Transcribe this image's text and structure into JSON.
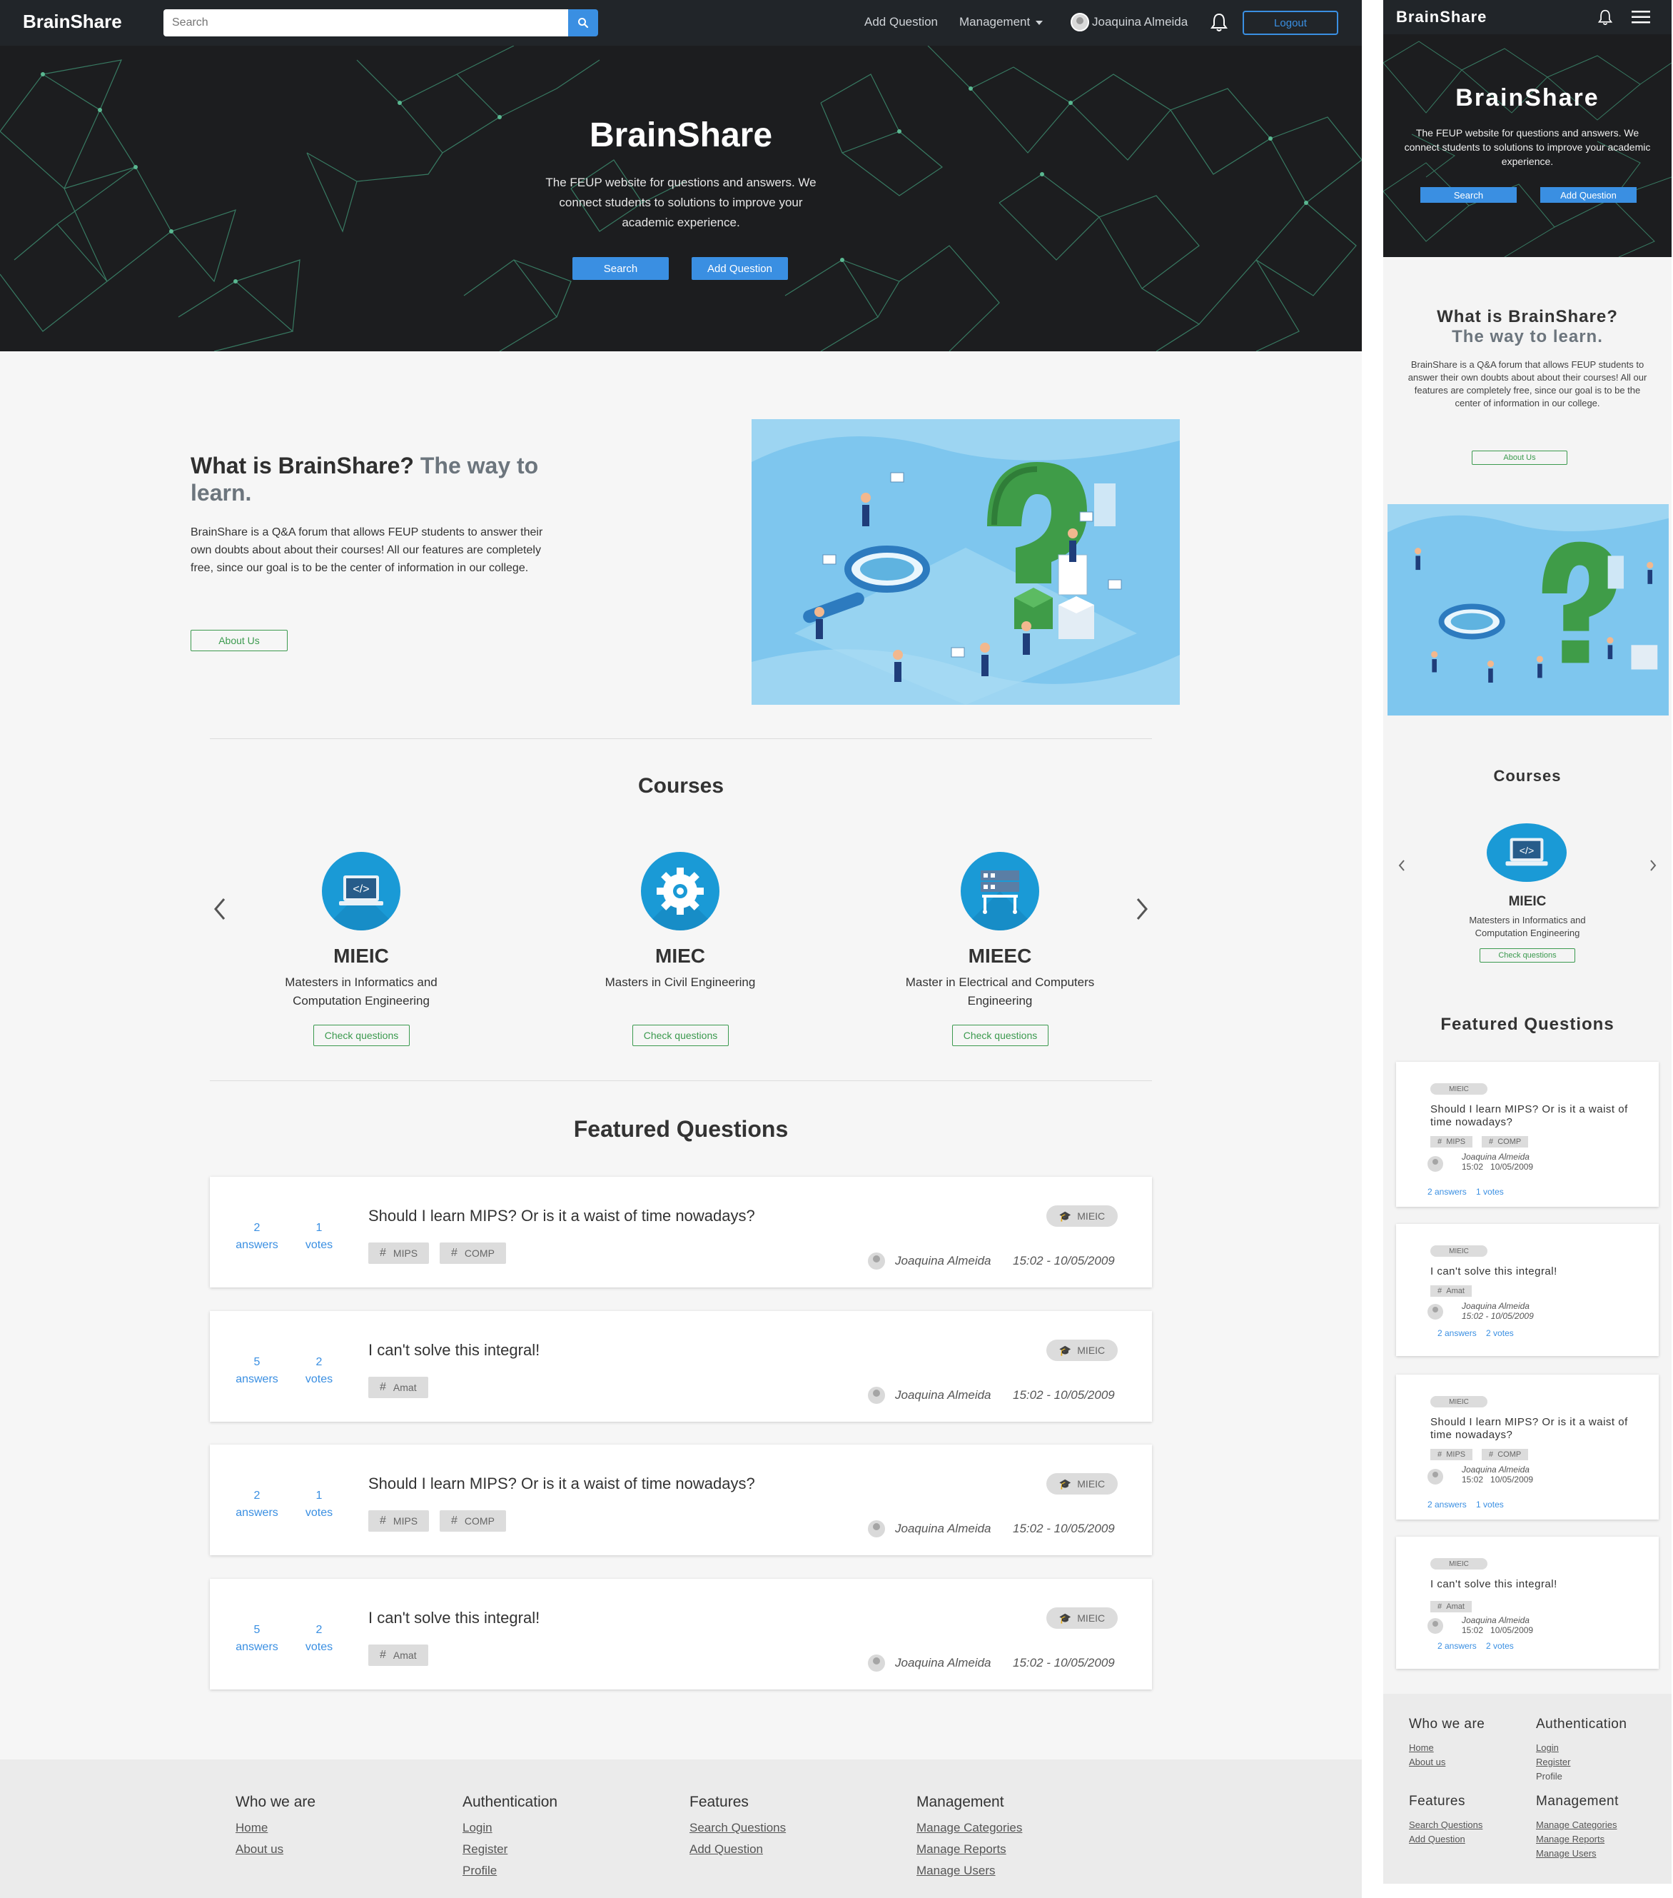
{
  "nav": {
    "brand": "BrainShare",
    "search_placeholder": "Search",
    "add_question": "Add Question",
    "management": "Management",
    "user_name": "Joaquina Almeida",
    "logout": "Logout"
  },
  "hero": {
    "title": "BrainShare",
    "subtitle": "The FEUP website for questions and answers. We connect students to solutions to improve your academic experience.",
    "search_btn": "Search",
    "add_btn": "Add Question"
  },
  "about": {
    "title_main": "What is BrainShare?",
    "title_muted": "The way to learn.",
    "text": "BrainShare is a Q&A forum that allows FEUP students to answer their own doubts about about their courses! All our features are completely free, since our goal is to be the center of information in our college.",
    "button": "About Us"
  },
  "courses": {
    "title": "Courses",
    "items": [
      {
        "code": "MIEIC",
        "desc": "Matesters in Informatics and Computation Engineering",
        "button": "Check questions",
        "icon": "laptop-code-icon"
      },
      {
        "code": "MIEC",
        "desc": "Masters in Civil Engineering",
        "button": "Check questions",
        "icon": "gear-icon"
      },
      {
        "code": "MIEEC",
        "desc": "Master in Electrical and Computers Engineering",
        "button": "Check questions",
        "icon": "server-icon"
      }
    ]
  },
  "featured": {
    "title": "Featured Questions",
    "questions": [
      {
        "answers": "2",
        "answers_label": "answers",
        "votes": "1",
        "votes_label": "votes",
        "title": "Should I learn MIPS? Or is it a waist of time nowadays?",
        "tags": [
          "MIPS",
          "COMP"
        ],
        "course": "MIEIC",
        "author": "Joaquina Almeida",
        "time": "15:02",
        "date": "10/05/2009",
        "datetime": "15:02 - 10/05/2009"
      },
      {
        "answers": "5",
        "answers_label": "answers",
        "votes": "2",
        "votes_label": "votes",
        "title": "I can't solve this integral!",
        "tags": [
          "Amat"
        ],
        "course": "MIEIC",
        "author": "Joaquina Almeida",
        "time": "15:02",
        "date": "10/05/2009",
        "datetime": "15:02 - 10/05/2009"
      },
      {
        "answers": "2",
        "answers_label": "answers",
        "votes": "1",
        "votes_label": "votes",
        "title": "Should I learn MIPS? Or is it a waist of time nowadays?",
        "tags": [
          "MIPS",
          "COMP"
        ],
        "course": "MIEIC",
        "author": "Joaquina Almeida",
        "time": "15:02",
        "date": "10/05/2009",
        "datetime": "15:02 - 10/05/2009"
      },
      {
        "answers": "5",
        "answers_label": "answers",
        "votes": "2",
        "votes_label": "votes",
        "title": "I can't solve this integral!",
        "tags": [
          "Amat"
        ],
        "course": "MIEIC",
        "author": "Joaquina Almeida",
        "time": "15:02",
        "date": "10/05/2009",
        "datetime": "15:02 - 10/05/2009"
      }
    ]
  },
  "mobile_stats": [
    "2 answers",
    "1 votes",
    "2 answers",
    "2 votes",
    "2 answers",
    "1 votes",
    "2 answers",
    "2 votes"
  ],
  "footer": {
    "who": {
      "title": "Who we are",
      "links": [
        "Home",
        "About us"
      ]
    },
    "auth": {
      "title": "Authentication",
      "links": [
        "Login",
        "Register",
        "Profile"
      ]
    },
    "features": {
      "title": "Features",
      "links": [
        "Search Questions",
        "Add Question"
      ]
    },
    "management": {
      "title": "Management",
      "links": [
        "Manage Categories",
        "Manage Reports",
        "Manage Users"
      ]
    }
  },
  "colors": {
    "accent": "#3a8fe2",
    "success": "#3c9a4f",
    "dark": "#212529"
  }
}
